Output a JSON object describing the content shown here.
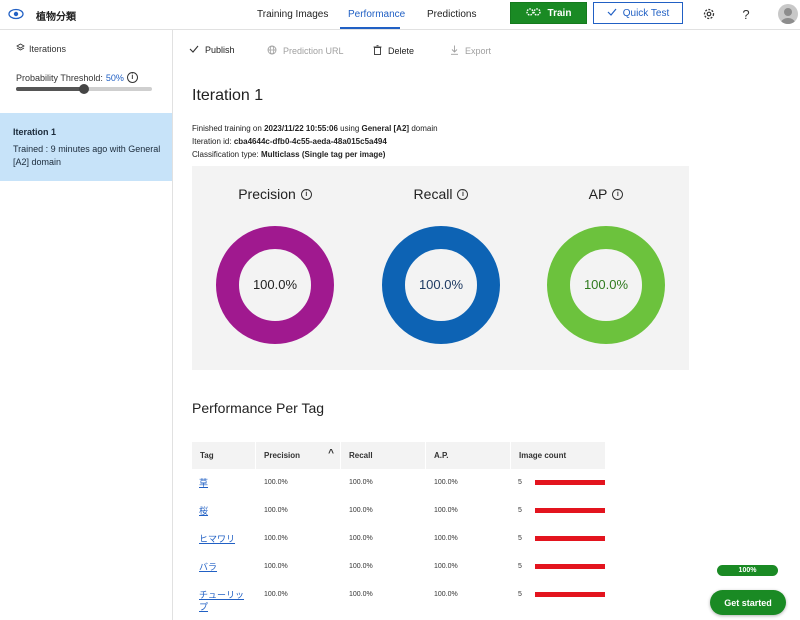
{
  "app": {
    "name": "植物分類"
  },
  "nav": {
    "tabs": [
      {
        "label": "Training Images"
      },
      {
        "label": "Performance"
      },
      {
        "label": "Predictions"
      }
    ]
  },
  "header": {
    "train_label": "Train",
    "quick_test_label": "Quick Test",
    "help_label": "?"
  },
  "sidebar": {
    "iterations_label": "Iterations",
    "threshold_label": "Probability Threshold:",
    "threshold_value": "50%",
    "threshold_fraction": 0.5,
    "iteration": {
      "title": "Iteration 1",
      "subtitle": "Trained : 9 minutes ago with General [A2] domain"
    }
  },
  "toolbar": {
    "publish": "Publish",
    "prediction_url": "Prediction URL",
    "delete": "Delete",
    "export": "Export"
  },
  "main": {
    "title": "Iteration 1",
    "finished_prefix": "Finished training on",
    "finished_date": "2023/11/22 10:55:06",
    "finished_using": "using",
    "finished_domain": "General [A2]",
    "finished_suffix": "domain",
    "iteration_id_label": "Iteration id:",
    "iteration_id": "cba4644c-dfb0-4c55-aeda-48a015c5a494",
    "class_type_label": "Classification type:",
    "class_type": "Multiclass (Single tag per image)"
  },
  "metrics": [
    {
      "label": "Precision",
      "value": "100.0%",
      "fraction": 1.0,
      "color": "#a0198f"
    },
    {
      "label": "Recall",
      "value": "100.0%",
      "fraction": 1.0,
      "color": "#0d63b4"
    },
    {
      "label": "AP",
      "value": "100.0%",
      "fraction": 1.0,
      "color": "#6cc23d"
    }
  ],
  "per_tag": {
    "title": "Performance Per Tag",
    "columns": {
      "tag": "Tag",
      "precision": "Precision",
      "recall": "Recall",
      "ap": "A.P.",
      "image_count": "Image count"
    },
    "sort_indicator": "^",
    "rows": [
      {
        "tag": "草",
        "precision": "100.0%",
        "recall": "100.0%",
        "ap": "100.0%",
        "count": "5"
      },
      {
        "tag": "桜",
        "precision": "100.0%",
        "recall": "100.0%",
        "ap": "100.0%",
        "count": "5"
      },
      {
        "tag": "ヒマワリ",
        "precision": "100.0%",
        "recall": "100.0%",
        "ap": "100.0%",
        "count": "5"
      },
      {
        "tag": "バラ",
        "precision": "100.0%",
        "recall": "100.0%",
        "ap": "100.0%",
        "count": "5"
      },
      {
        "tag": "チューリップ",
        "precision": "100.0%",
        "recall": "100.0%",
        "ap": "100.0%",
        "count": "5"
      }
    ]
  },
  "footer": {
    "progress_label": "100%",
    "progress_fraction": 1.0,
    "get_started_label": "Get started"
  },
  "colors": {
    "accent": "#2160c4",
    "train_green": "#1a8a24",
    "selected_bg": "#c7e3f9",
    "bar_red": "#e3141e"
  }
}
